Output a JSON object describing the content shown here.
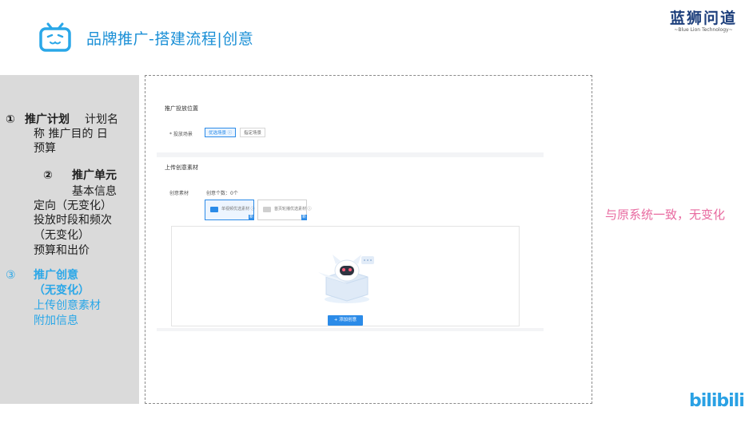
{
  "header": {
    "title": "品牌推广-搭建流程|创意",
    "logo_main": "蓝狮问道",
    "logo_sub": "~Blue Lion Technology~"
  },
  "left_panel": {
    "step1_num": "①",
    "step1_title": "推广计划",
    "step1_line1_rest": "计划名",
    "step1_line2": "称 推广目的 日",
    "step1_line3": "预算",
    "step2_num": "②",
    "step2_title": "推广单元",
    "step2_lines": [
      "基本信息",
      "定向（无变化）",
      "投放时段和频次",
      "（无变化）",
      "预算和出价"
    ],
    "step3_num": "③",
    "step3_title": "推广创意",
    "step3_lines": [
      "（无变化）",
      "上传创意素材",
      "附加信息"
    ]
  },
  "screenshot": {
    "section1_title": "推广投放位置",
    "scene_label": "* 投放场景",
    "scene_options": [
      "优选场景 ⓘ",
      "指定场景"
    ],
    "section2_title": "上传创意素材",
    "creative_label": "创意素材",
    "creative_count": "创意个数：0个",
    "tiles": [
      "单视频优选素材 ⓘ",
      "首页轮播优选素材 ⓘ"
    ],
    "tile_badges": [
      "新",
      "新"
    ],
    "add_button": "+ 添加创意"
  },
  "side_note": "与原系统一致，无变化",
  "brand_watermark": "bilibili",
  "colors": {
    "title_blue": "#1a8fd6",
    "accent_blue": "#2aa7e8",
    "note_pink": "#e86aa0",
    "panel_grey": "#dadada"
  }
}
